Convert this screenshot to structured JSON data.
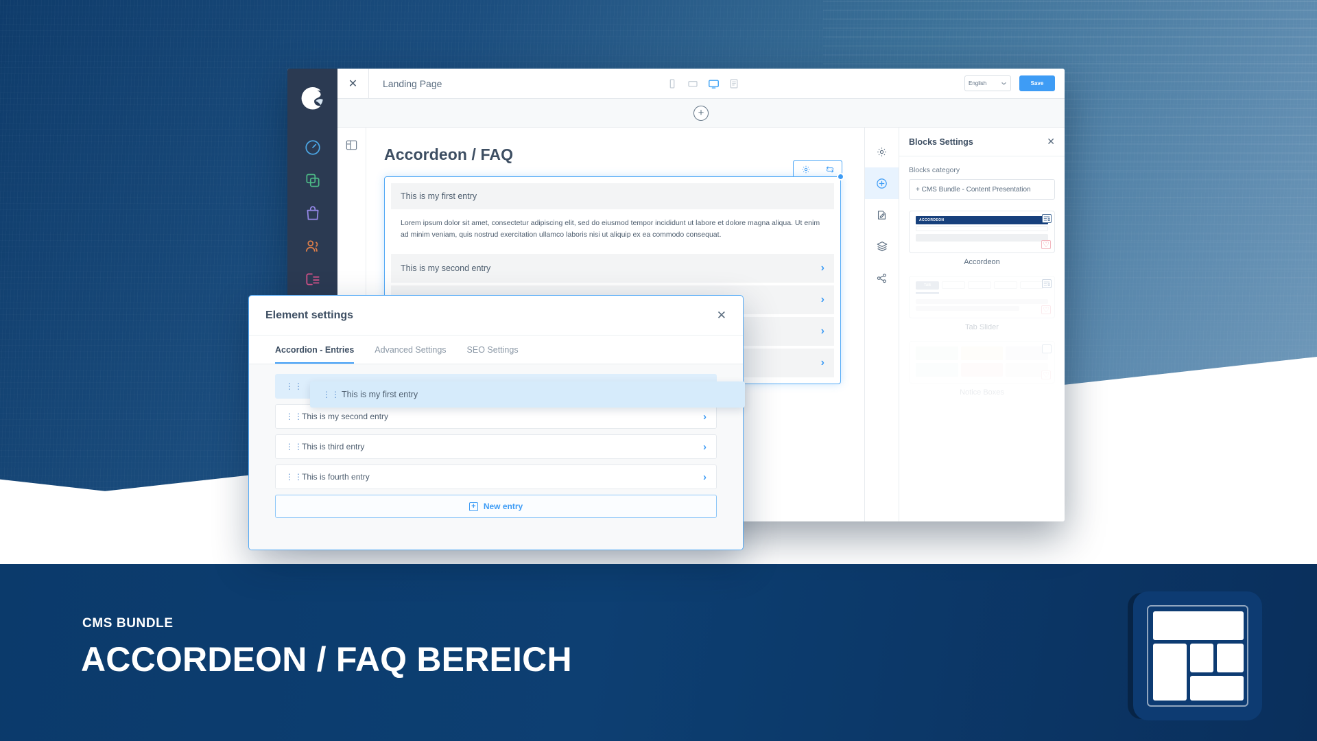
{
  "background": {
    "accent": "#3e9cf5",
    "deep_blue": "#0d3b72"
  },
  "banner": {
    "eyebrow": "CMS BUNDLE",
    "title": "ACCORDEON / FAQ BEREICH",
    "logo_name": "cms-layout-logo"
  },
  "admin": {
    "left_rail": {
      "logo": "shopware-logo",
      "items": [
        {
          "name": "dashboard-icon",
          "color": "#4eaef0"
        },
        {
          "name": "catalogues-icon",
          "color": "#4fc18a"
        },
        {
          "name": "orders-icon",
          "color": "#9b8df0"
        },
        {
          "name": "customers-icon",
          "color": "#e8834a"
        },
        {
          "name": "content-icon",
          "color": "#e0548e"
        }
      ]
    },
    "topbar": {
      "close_label": "✕",
      "title": "Landing Page",
      "devices": [
        {
          "name": "mobile-preview",
          "active": false
        },
        {
          "name": "tablet-preview",
          "active": false
        },
        {
          "name": "desktop-preview",
          "active": true
        },
        {
          "name": "document-preview",
          "active": false
        }
      ],
      "language": "English",
      "save_label": "Save"
    },
    "add_section_label": "+",
    "canvas": {
      "heading": "Accordeon / FAQ",
      "accordion": {
        "entries": [
          {
            "title": "This is my first entry",
            "body": "Lorem ipsum dolor sit amet, consectetur adipiscing elit, sed do eiusmod tempor incididunt ut labore et dolore magna aliqua. Ut enim ad minim veniam, quis nostrud exercitation ullamco laboris nisi ut aliquip ex ea commodo consequat.",
            "open": true
          },
          {
            "title": "This is my second entry",
            "open": false
          },
          {
            "title": "",
            "open": false
          },
          {
            "title": "",
            "open": false
          },
          {
            "title": "",
            "open": false
          }
        ],
        "toolbar": [
          {
            "name": "element-settings-gear-icon"
          },
          {
            "name": "element-swap-icon"
          }
        ]
      }
    },
    "right_rail": [
      {
        "name": "page-settings-icon",
        "active": false
      },
      {
        "name": "add-blocks-icon",
        "active": true
      },
      {
        "name": "edit-content-icon",
        "active": false
      },
      {
        "name": "layers-icon",
        "active": false
      },
      {
        "name": "share-icon",
        "active": false
      }
    ],
    "blocks_panel": {
      "title": "Blocks Settings",
      "close_label": "✕",
      "category_label": "Blocks category",
      "category_value": "+ CMS Bundle - Content Presentation",
      "blocks": [
        {
          "name": "Accordeon",
          "preview_label": "ACCORDEON"
        },
        {
          "name": "Tab Slider",
          "preview_label": "TAB"
        },
        {
          "name": "Notice Boxes",
          "preview_label": ""
        }
      ]
    }
  },
  "modal": {
    "title": "Element settings",
    "close_label": "✕",
    "tabs": [
      {
        "label": "Accordion - Entries",
        "active": true
      },
      {
        "label": "Advanced Settings",
        "active": false
      },
      {
        "label": "SEO Settings",
        "active": false
      }
    ],
    "entries": [
      {
        "label": "This is my first entry",
        "dragging": true
      },
      {
        "label": "This is my second entry",
        "dragging": false
      },
      {
        "label": "This is third entry",
        "dragging": false
      },
      {
        "label": "This is fourth entry",
        "dragging": false
      }
    ],
    "partial_text": "entry",
    "new_entry_label": "New entry"
  }
}
